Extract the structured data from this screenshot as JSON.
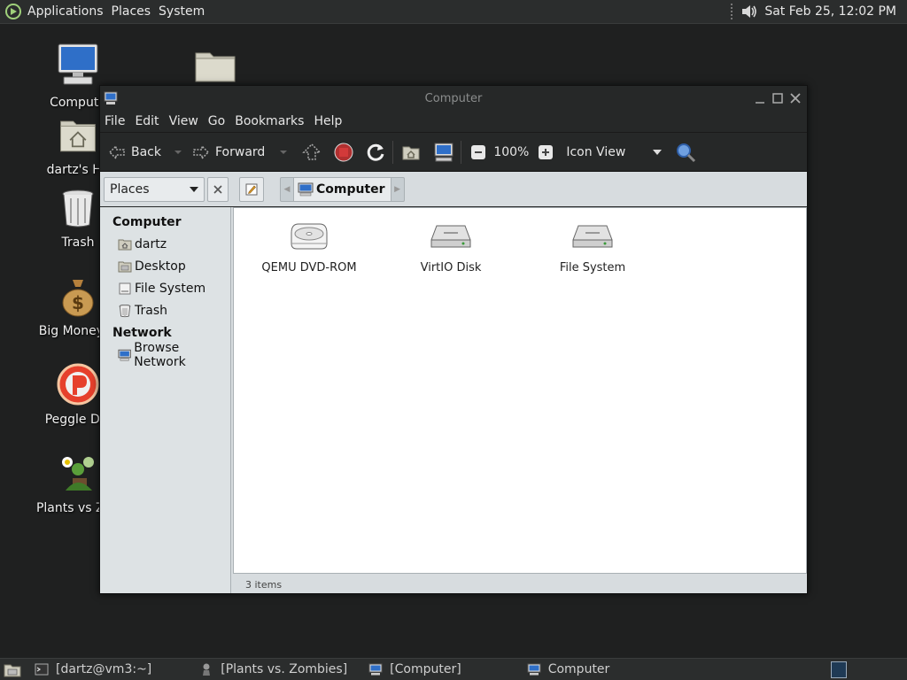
{
  "top_panel": {
    "menus": [
      "Applications",
      "Places",
      "System"
    ],
    "clock": "Sat Feb 25, 12:02 PM"
  },
  "desktop_icons": [
    {
      "label": "Compute",
      "icon": "computer-icon"
    },
    {
      "label": "dartz's Ho",
      "icon": "home-folder-icon"
    },
    {
      "label": "Trash",
      "icon": "trash-icon"
    },
    {
      "label": "Big Money D",
      "icon": "money-bag-icon"
    },
    {
      "label": "Peggle Del",
      "icon": "peggle-icon"
    },
    {
      "label": "Plants vs Zon",
      "icon": "plants-vs-zombies-icon"
    }
  ],
  "window": {
    "title": "Computer",
    "menu": [
      "File",
      "Edit",
      "View",
      "Go",
      "Bookmarks",
      "Help"
    ],
    "toolbar": {
      "back": "Back",
      "forward": "Forward",
      "zoom": "100%",
      "view_mode": "Icon View"
    },
    "location": {
      "places_combo": "Places",
      "crumb": "Computer"
    },
    "sidebar": {
      "sections": [
        {
          "title": "Computer",
          "items": [
            {
              "label": "dartz",
              "icon": "home-folder-icon"
            },
            {
              "label": "Desktop",
              "icon": "desktop-folder-icon"
            },
            {
              "label": "File System",
              "icon": "drive-icon"
            },
            {
              "label": "Trash",
              "icon": "trash-icon"
            }
          ]
        },
        {
          "title": "Network",
          "items": [
            {
              "label": "Browse Network",
              "icon": "network-icon"
            }
          ]
        }
      ]
    },
    "files": [
      {
        "label": "QEMU DVD-ROM",
        "icon": "dvd-drive-icon"
      },
      {
        "label": "VirtIO Disk",
        "icon": "hard-disk-icon"
      },
      {
        "label": "File System",
        "icon": "hard-disk-icon"
      }
    ],
    "status": "3 items"
  },
  "taskbar": {
    "tasks": [
      {
        "label": "[dartz@vm3:~]",
        "icon": "terminal-icon"
      },
      {
        "label": "[Plants vs. Zombies]",
        "icon": "zombie-icon"
      },
      {
        "label": "[Computer]",
        "icon": "computer-icon"
      },
      {
        "label": "Computer",
        "icon": "computer-icon"
      }
    ]
  }
}
